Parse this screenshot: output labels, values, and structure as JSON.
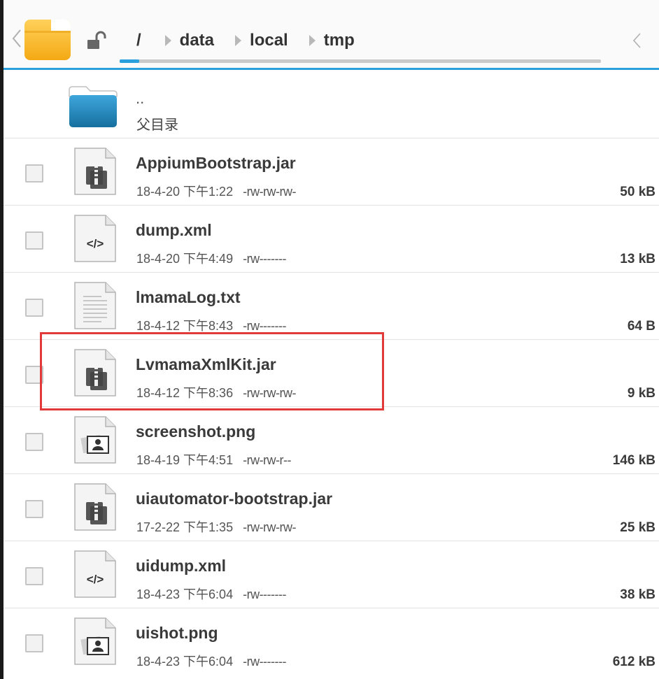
{
  "header": {
    "breadcrumbs": [
      "/",
      "data",
      "local",
      "tmp"
    ],
    "icons": {
      "back": "chevron-left-icon",
      "app": "folder-app-icon",
      "lock": "unlocked-padlock-icon",
      "scroll_back": "chevron-left-icon"
    },
    "scroll_progress": 0.04
  },
  "parent": {
    "dots": "..",
    "label": "父目录"
  },
  "files": [
    {
      "name": "AppiumBootstrap.jar",
      "date": "18-4-20 下午1:22",
      "perm": "-rw-rw-rw-",
      "size": "50 kB",
      "type": "archive"
    },
    {
      "name": "dump.xml",
      "date": "18-4-20 下午4:49",
      "perm": "-rw-------",
      "size": "13 kB",
      "type": "code"
    },
    {
      "name": "lmamaLog.txt",
      "date": "18-4-12 下午8:43",
      "perm": "-rw-------",
      "size": "64 B",
      "type": "text"
    },
    {
      "name": "LvmamaXmlKit.jar",
      "date": "18-4-12 下午8:36",
      "perm": "-rw-rw-rw-",
      "size": "9 kB",
      "type": "archive"
    },
    {
      "name": "screenshot.png",
      "date": "18-4-19 下午4:51",
      "perm": "-rw-rw-r--",
      "size": "146 kB",
      "type": "image"
    },
    {
      "name": "uiautomator-bootstrap.jar",
      "date": "17-2-22 下午1:35",
      "perm": "-rw-rw-rw-",
      "size": "25 kB",
      "type": "archive"
    },
    {
      "name": "uidump.xml",
      "date": "18-4-23 下午6:04",
      "perm": "-rw-------",
      "size": "38 kB",
      "type": "code"
    },
    {
      "name": "uishot.png",
      "date": "18-4-23 下午6:04",
      "perm": "-rw-------",
      "size": "612 kB",
      "type": "image"
    }
  ],
  "colors": {
    "accent": "#2aa0dc",
    "highlight": "#e23a3a",
    "folder_yellow": "#f6b51b",
    "folder_blue": "#1d7fb5"
  }
}
